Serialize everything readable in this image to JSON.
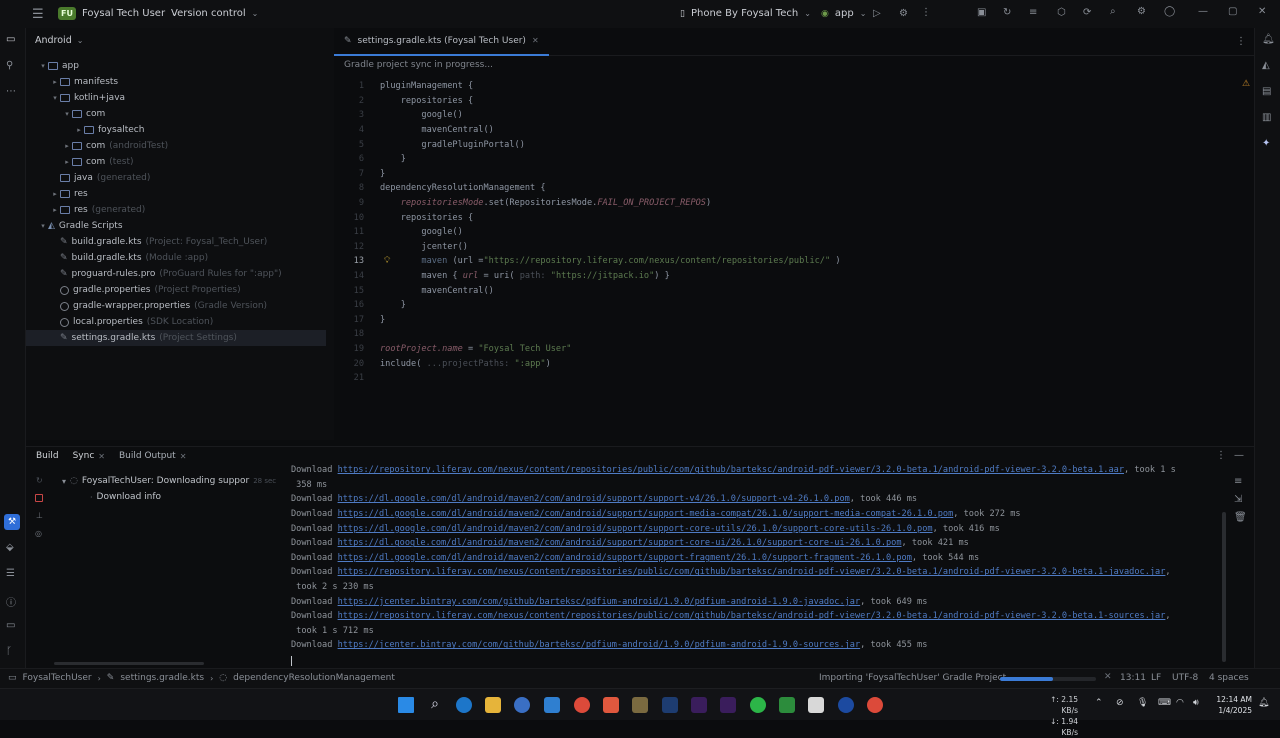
{
  "titlebar": {
    "project_badge": "FU",
    "project_name": "Foysal Tech User",
    "version_control": "Version control",
    "device": "Phone By Foysal Tech",
    "run_config": "app"
  },
  "project_panel": {
    "view_label": "Android",
    "tree": [
      {
        "label": "app",
        "hint": "",
        "indent": 1,
        "arrow": "▾",
        "icon": "folder"
      },
      {
        "label": "manifests",
        "hint": "",
        "indent": 2,
        "arrow": "▸",
        "icon": "folder"
      },
      {
        "label": "kotlin+java",
        "hint": "",
        "indent": 2,
        "arrow": "▾",
        "icon": "folder"
      },
      {
        "label": "com",
        "hint": "",
        "indent": 3,
        "arrow": "▾",
        "icon": "folder"
      },
      {
        "label": "foysaltech",
        "hint": "",
        "indent": 4,
        "arrow": "▸",
        "icon": "folder"
      },
      {
        "label": "com",
        "hint": "(androidTest)",
        "indent": 3,
        "arrow": "▸",
        "icon": "folder"
      },
      {
        "label": "com",
        "hint": "(test)",
        "indent": 3,
        "arrow": "▸",
        "icon": "folder"
      },
      {
        "label": "java",
        "hint": "(generated)",
        "indent": 2,
        "arrow": "",
        "icon": "folder"
      },
      {
        "label": "res",
        "hint": "",
        "indent": 2,
        "arrow": "▸",
        "icon": "folder"
      },
      {
        "label": "res",
        "hint": "(generated)",
        "indent": 2,
        "arrow": "▸",
        "icon": "folder"
      },
      {
        "label": "Gradle Scripts",
        "hint": "",
        "indent": 1,
        "arrow": "▾",
        "icon": "gradle"
      },
      {
        "label": "build.gradle.kts",
        "hint": "(Project: Foysal_Tech_User)",
        "indent": 2,
        "arrow": "",
        "icon": "file"
      },
      {
        "label": "build.gradle.kts",
        "hint": "(Module :app)",
        "indent": 2,
        "arrow": "",
        "icon": "file"
      },
      {
        "label": "proguard-rules.pro",
        "hint": "(ProGuard Rules for \":app\")",
        "indent": 2,
        "arrow": "",
        "icon": "file"
      },
      {
        "label": "gradle.properties",
        "hint": "(Project Properties)",
        "indent": 2,
        "arrow": "",
        "icon": "gear"
      },
      {
        "label": "gradle-wrapper.properties",
        "hint": "(Gradle Version)",
        "indent": 2,
        "arrow": "",
        "icon": "gear"
      },
      {
        "label": "local.properties",
        "hint": "(SDK Location)",
        "indent": 2,
        "arrow": "",
        "icon": "gear"
      },
      {
        "label": "settings.gradle.kts",
        "hint": "(Project Settings)",
        "indent": 2,
        "arrow": "",
        "icon": "file",
        "selected": true
      }
    ]
  },
  "editor": {
    "tab_label": "settings.gradle.kts (Foysal Tech User)",
    "banner": "Gradle project sync in progress...",
    "lines": [
      [
        {
          "t": "pluginManagement {",
          "c": "k"
        }
      ],
      [
        {
          "t": "    repositories {",
          "c": "k"
        }
      ],
      [
        {
          "t": "        google()",
          "c": "k"
        }
      ],
      [
        {
          "t": "        mavenCentral()",
          "c": "k"
        }
      ],
      [
        {
          "t": "        gradlePluginPortal()",
          "c": "k"
        }
      ],
      [
        {
          "t": "    }",
          "c": "k"
        }
      ],
      [
        {
          "t": "}",
          "c": "k"
        }
      ],
      [
        {
          "t": "dependencyResolutionManagement {",
          "c": "k"
        }
      ],
      [
        {
          "t": "    ",
          "c": "k"
        },
        {
          "t": "repositoriesMode",
          "c": "it"
        },
        {
          "t": ".set(RepositoriesMode.",
          "c": "k"
        },
        {
          "t": "FAIL_ON_PROJECT_REPOS",
          "c": "it"
        },
        {
          "t": ")",
          "c": "k"
        }
      ],
      [
        {
          "t": "    repositories {",
          "c": "k"
        }
      ],
      [
        {
          "t": "        google()",
          "c": "k"
        }
      ],
      [
        {
          "t": "        jcenter()",
          "c": "k"
        }
      ],
      [
        {
          "t": "        maven ",
          "c": "u"
        },
        {
          "t": "(url =",
          "c": "k"
        },
        {
          "t": "\"https://repository.liferay.com/nexus/content/repositories/public/\"",
          "c": "s"
        },
        {
          "t": " )",
          "c": "k"
        }
      ],
      [
        {
          "t": "        maven { ",
          "c": "k"
        },
        {
          "t": "url",
          "c": "it"
        },
        {
          "t": " = uri( ",
          "c": "k"
        },
        {
          "t": "path: ",
          "c": "par"
        },
        {
          "t": "\"https://jitpack.io\"",
          "c": "s"
        },
        {
          "t": ") }",
          "c": "k"
        }
      ],
      [
        {
          "t": "        mavenCentral()",
          "c": "k"
        }
      ],
      [
        {
          "t": "    }",
          "c": "k"
        }
      ],
      [
        {
          "t": "}",
          "c": "k"
        }
      ],
      [
        {
          "t": "",
          "c": "k"
        }
      ],
      [
        {
          "t": "rootProject.",
          "c": "it"
        },
        {
          "t": "name",
          "c": "it"
        },
        {
          "t": " = ",
          "c": "k"
        },
        {
          "t": "\"Foysal Tech User\"",
          "c": "s"
        }
      ],
      [
        {
          "t": "include( ",
          "c": "k"
        },
        {
          "t": "...projectPaths: ",
          "c": "par"
        },
        {
          "t": "\":app\"",
          "c": "s"
        },
        {
          "t": ")",
          "c": "k"
        }
      ],
      [
        {
          "t": "",
          "c": "k"
        }
      ]
    ]
  },
  "build_panel": {
    "tabs": [
      "Build",
      "Sync",
      "Build Output"
    ],
    "tree_task": "FoysalTechUser: Downloading suppor",
    "tree_time": "28 sec",
    "tree_child": "Download info",
    "log": [
      {
        "pre": "Download ",
        "url": "https://repository.liferay.com/nexus/content/repositories/public/com/github/barteksc/android-pdf-viewer/3.2.0-beta.1/android-pdf-viewer-3.2.0-beta.1.aar",
        "post": ", took 1 s"
      },
      {
        "pre": " 358 ms",
        "url": "",
        "post": ""
      },
      {
        "pre": "Download ",
        "url": "https://dl.google.com/dl/android/maven2/com/android/support/support-v4/26.1.0/support-v4-26.1.0.pom",
        "post": ", took 446 ms"
      },
      {
        "pre": "Download ",
        "url": "https://dl.google.com/dl/android/maven2/com/android/support/support-media-compat/26.1.0/support-media-compat-26.1.0.pom",
        "post": ", took 272 ms"
      },
      {
        "pre": "Download ",
        "url": "https://dl.google.com/dl/android/maven2/com/android/support/support-core-utils/26.1.0/support-core-utils-26.1.0.pom",
        "post": ", took 416 ms"
      },
      {
        "pre": "Download ",
        "url": "https://dl.google.com/dl/android/maven2/com/android/support/support-core-ui/26.1.0/support-core-ui-26.1.0.pom",
        "post": ", took 421 ms"
      },
      {
        "pre": "Download ",
        "url": "https://dl.google.com/dl/android/maven2/com/android/support/support-fragment/26.1.0/support-fragment-26.1.0.pom",
        "post": ", took 544 ms"
      },
      {
        "pre": "Download ",
        "url": "https://repository.liferay.com/nexus/content/repositories/public/com/github/barteksc/android-pdf-viewer/3.2.0-beta.1/android-pdf-viewer-3.2.0-beta.1-javadoc.jar",
        "post": ","
      },
      {
        "pre": " took 2 s 230 ms",
        "url": "",
        "post": ""
      },
      {
        "pre": "Download ",
        "url": "https://jcenter.bintray.com/com/github/barteksc/pdfium-android/1.9.0/pdfium-android-1.9.0-javadoc.jar",
        "post": ", took 649 ms"
      },
      {
        "pre": "Download ",
        "url": "https://repository.liferay.com/nexus/content/repositories/public/com/github/barteksc/android-pdf-viewer/3.2.0-beta.1/android-pdf-viewer-3.2.0-beta.1-sources.jar",
        "post": ","
      },
      {
        "pre": " took 1 s 712 ms",
        "url": "",
        "post": ""
      },
      {
        "pre": "Download ",
        "url": "https://jcenter.bintray.com/com/github/barteksc/pdfium-android/1.9.0/pdfium-android-1.9.0-sources.jar",
        "post": ", took 455 ms"
      }
    ]
  },
  "statusbar": {
    "crumbs": [
      "FoysalTechUser",
      "settings.gradle.kts",
      "dependencyResolutionManagement"
    ],
    "task": "Importing 'FoysalTechUser' Gradle Project",
    "progress": 0.55,
    "position": "13:11",
    "line_sep": "LF",
    "encoding": "UTF-8",
    "indent": "4 spaces"
  },
  "taskbar": {
    "net_up": "↑: 2.15 KB/s",
    "net_down": "↓: 1.94 KB/s",
    "time": "12:14 AM",
    "date": "1/4/2025"
  },
  "colors": {
    "accent": "#3b7bd6",
    "badge": "#4a7a2c",
    "link": "#4f7bc4"
  }
}
